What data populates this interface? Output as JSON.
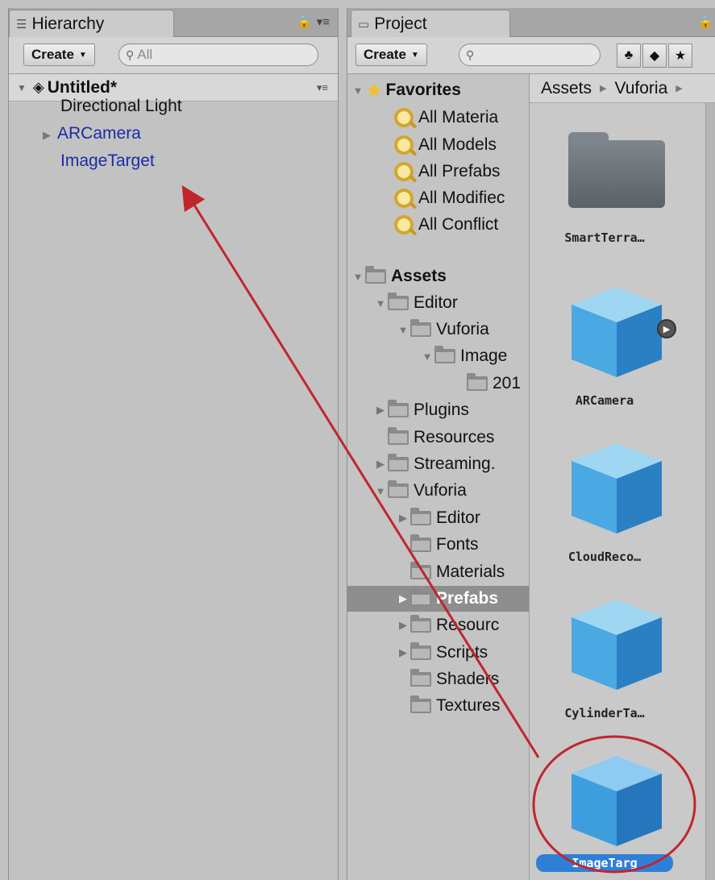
{
  "hierarchy": {
    "tab_title": "Hierarchy",
    "create_label": "Create",
    "search_placeholder": "All",
    "scene_name": "Untitled*",
    "items": [
      {
        "label": "Directional Light"
      },
      {
        "label": "ARCamera"
      },
      {
        "label": "ImageTarget"
      }
    ]
  },
  "project": {
    "tab_title": "Project",
    "create_label": "Create",
    "tree": {
      "favorites_label": "Favorites",
      "favorites": [
        "All Materia",
        "All Models",
        "All Prefabs",
        "All Modifiec",
        "All Conflict"
      ],
      "assets_label": "Assets",
      "folders": [
        "Editor",
        "Vuforia",
        "Image",
        "201",
        "Plugins",
        "Resources",
        "Streaming.",
        "Vuforia",
        "Editor",
        "Fonts",
        "Materials",
        "Prefabs",
        "Resourc",
        "Scripts",
        "Shaders",
        "Textures"
      ]
    },
    "breadcrumb": [
      "Assets",
      "Vuforia"
    ],
    "assets": [
      {
        "label": "SmartTerra…",
        "icon": "folder-icon"
      },
      {
        "label": "ARCamera",
        "icon": "prefab-cube-icon"
      },
      {
        "label": "CloudReco…",
        "icon": "prefab-cube-icon"
      },
      {
        "label": "CylinderTa…",
        "icon": "prefab-cube-icon"
      },
      {
        "label": "ImageTarg",
        "icon": "prefab-cube-icon",
        "selected": true
      }
    ]
  },
  "annotation": {
    "arrow_color": "#c0262d",
    "highlight_color": "#c0262d"
  },
  "colors": {
    "panel_bg": "#c2c2c2",
    "link_blue": "#1b2ba6",
    "selection_blue": "#2f7fd6",
    "tree_selected": "#8e8e8e"
  }
}
